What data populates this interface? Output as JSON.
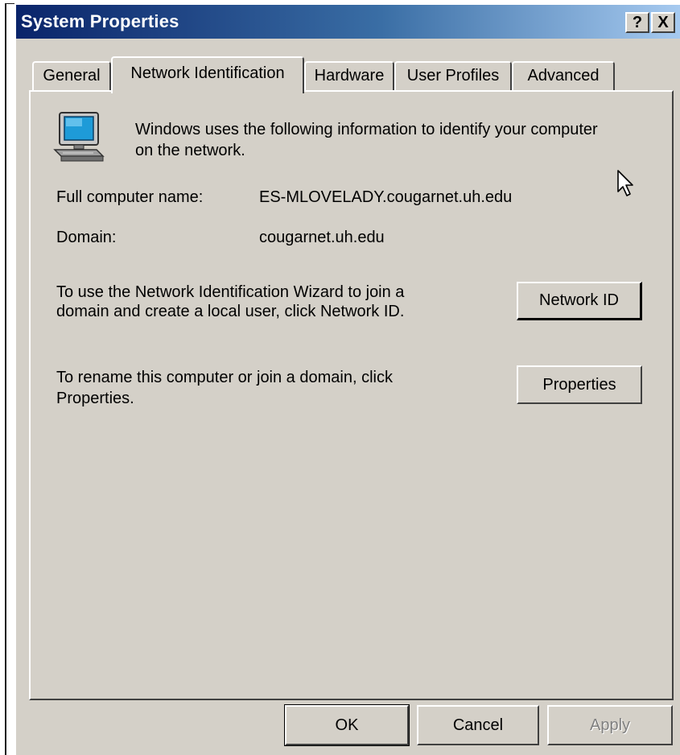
{
  "window": {
    "title": "System Properties"
  },
  "titlebar_buttons": {
    "help": "?",
    "close": "X"
  },
  "tabs": [
    {
      "label": "General",
      "active": false
    },
    {
      "label": "Network Identification",
      "active": true
    },
    {
      "label": "Hardware",
      "active": false
    },
    {
      "label": "User Profiles",
      "active": false
    },
    {
      "label": "Advanced",
      "active": false
    }
  ],
  "intro": {
    "line1": "Windows uses the following information to identify your computer",
    "line2": "on the network.",
    "icon": "computer-icon"
  },
  "info": {
    "full_name_label": "Full computer name:",
    "full_name_value": "ES-MLOVELADY.cougarnet.uh.edu",
    "domain_label": "Domain:",
    "domain_value": "cougarnet.uh.edu"
  },
  "wizard": {
    "line1": "To use the Network Identification Wizard to join a",
    "line2": "domain and create a local user, click Network ID.",
    "button": "Network ID"
  },
  "rename": {
    "line1": "To rename this computer or join a domain, click",
    "line2": "Properties.",
    "button": "Properties"
  },
  "footer": {
    "ok": "OK",
    "cancel": "Cancel",
    "apply": "Apply"
  },
  "colors": {
    "title_start": "#0a246a",
    "title_end": "#a6caf0",
    "face": "#d4d0c8"
  }
}
